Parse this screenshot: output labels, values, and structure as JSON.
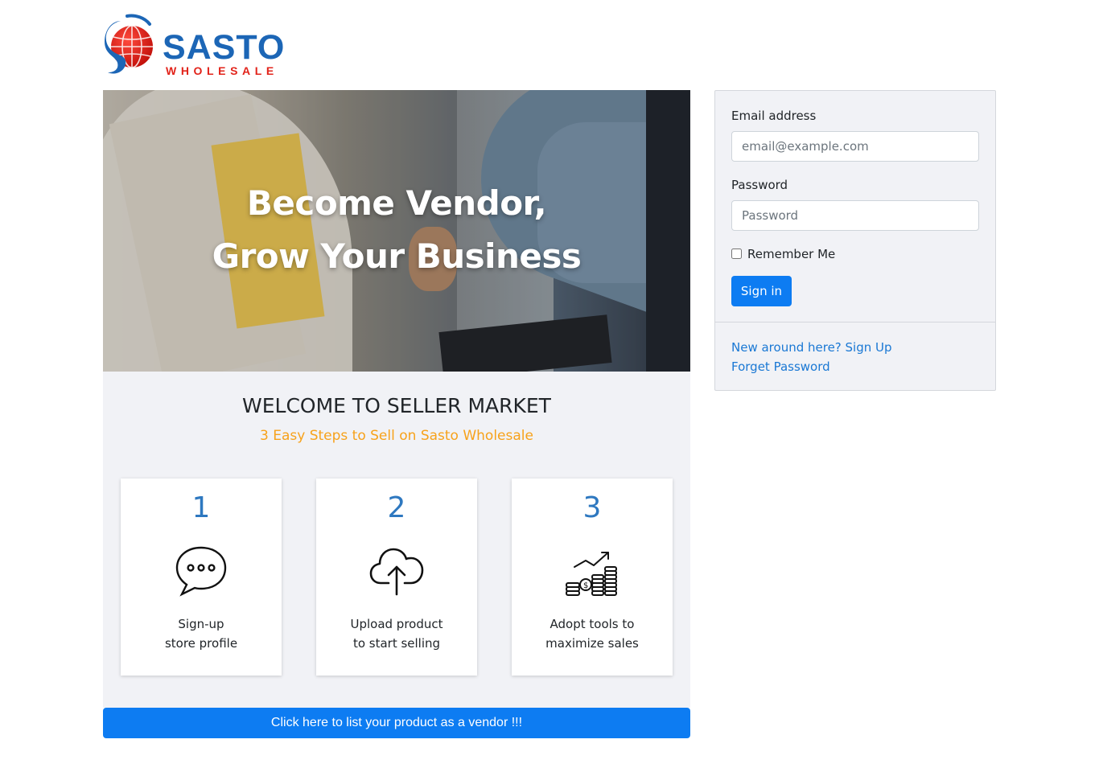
{
  "logo": {
    "brand": "SASTO",
    "subtitle": "WHOLESALE"
  },
  "hero": {
    "line1": "Become Vendor,",
    "line2": "Grow Your Business"
  },
  "welcome": {
    "title": "WELCOME TO SELLER MARKET",
    "subtitle": "3 Easy Steps to Sell on Sasto Wholesale"
  },
  "steps": [
    {
      "number": "1",
      "icon": "chat-bubble-icon",
      "line1": "Sign-up",
      "line2": "store profile"
    },
    {
      "number": "2",
      "icon": "cloud-upload-icon",
      "line1": "Upload product",
      "line2": "to start selling"
    },
    {
      "number": "3",
      "icon": "growth-coins-icon",
      "line1": "Adopt tools to",
      "line2": "maximize sales"
    }
  ],
  "cta": {
    "label": "Click here to list your product as a vendor !!!"
  },
  "login": {
    "email_label": "Email address",
    "email_placeholder": "email@example.com",
    "password_label": "Password",
    "password_placeholder": "Password",
    "remember_label": "Remember Me",
    "remember_checked": false,
    "signin_label": "Sign in",
    "signup_link": "New around here? Sign Up",
    "forgot_link": "Forget Password"
  },
  "colors": {
    "primary": "#0d7cf2",
    "brand_blue": "#1c66b6",
    "brand_red": "#e2231a",
    "accent_orange": "#f7a21b",
    "step_number": "#2e78c0",
    "panel_bg": "#f1f2f6"
  }
}
